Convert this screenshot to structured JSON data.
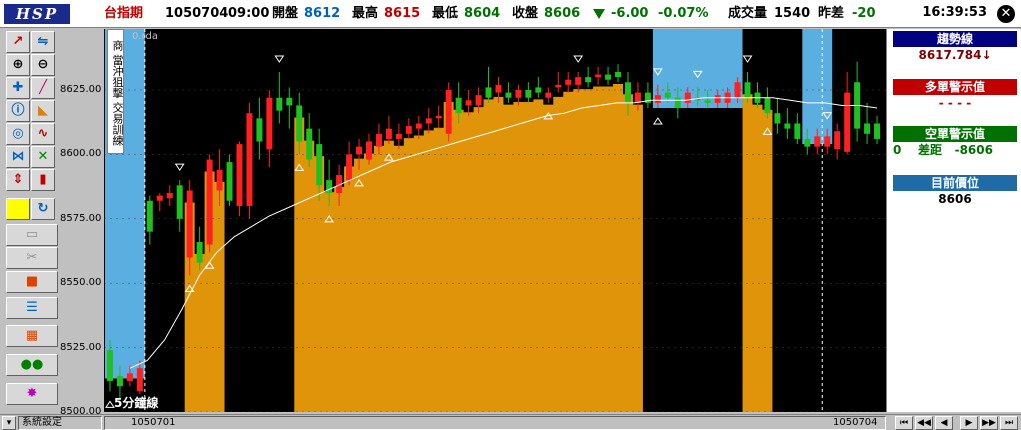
{
  "header": {
    "logo": "HSP",
    "symbol": "台指期",
    "date": "1050704",
    "time": "09:00",
    "open_label": "開盤",
    "open_value": "8612",
    "high_label": "最高",
    "high_value": "8615",
    "low_label": "最低",
    "low_value": "8604",
    "close_label": "收盤",
    "close_value": "8606",
    "change": "-6.00",
    "change_pct": "-0.07%",
    "volume_label": "成交量",
    "volume_value": "1540",
    "prev_diff_label": "昨差",
    "prev_diff_value": "-20",
    "clock": "16:39:53",
    "close_icon": "close-icon"
  },
  "toolbar": {
    "icons": [
      "trend-line-icon",
      "split-icon",
      "zoom-in-icon",
      "zoom-out-icon",
      "crosshair-icon",
      "pen-icon",
      "info-icon",
      "ruler-icon",
      "target-icon",
      "curve-icon",
      "pattern-icon",
      "cross-arrows-icon",
      "up-down-icon",
      "candle-icon",
      "color-swatch-icon",
      "refresh-icon",
      "folder-icon",
      "scissors-icon",
      "stop-icon",
      "list-icon",
      "grid-icon",
      "binoculars-icon",
      "alert-icon"
    ]
  },
  "chart_side_label": {
    "lines": [
      "商",
      "當沖狙擊",
      "交易訓練"
    ]
  },
  "chart_small_label": "0.rda",
  "interval_label": "5分鐘線",
  "chart_data": {
    "type": "candlestick",
    "y_ticks": [
      "8625.00",
      "8600.00",
      "8575.00",
      "8550.00",
      "8525.00",
      "8500.00"
    ],
    "ylim": [
      8500,
      8640
    ],
    "x_labels": [
      "1050701",
      "1050704"
    ],
    "candles": [
      {
        "o": 8524,
        "h": 8528,
        "l": 8508,
        "c": 8512
      },
      {
        "o": 8514,
        "h": 8518,
        "l": 8505,
        "c": 8510
      },
      {
        "o": 8512,
        "h": 8518,
        "l": 8510,
        "c": 8515
      },
      {
        "o": 8508,
        "h": 8520,
        "l": 8507,
        "c": 8517
      },
      {
        "o": 8582,
        "h": 8584,
        "l": 8565,
        "c": 8570
      },
      {
        "o": 8582,
        "h": 8585,
        "l": 8578,
        "c": 8584
      },
      {
        "o": 8583,
        "h": 8588,
        "l": 8580,
        "c": 8585
      },
      {
        "o": 8588,
        "h": 8590,
        "l": 8570,
        "c": 8575
      },
      {
        "o": 8560,
        "h": 8590,
        "l": 8553,
        "c": 8586
      },
      {
        "o": 8566,
        "h": 8572,
        "l": 8555,
        "c": 8558
      },
      {
        "o": 8565,
        "h": 8600,
        "l": 8562,
        "c": 8598
      },
      {
        "o": 8586,
        "h": 8602,
        "l": 8580,
        "c": 8594
      },
      {
        "o": 8597,
        "h": 8600,
        "l": 8580,
        "c": 8582
      },
      {
        "o": 8580,
        "h": 8605,
        "l": 8576,
        "c": 8604
      },
      {
        "o": 8580,
        "h": 8620,
        "l": 8575,
        "c": 8616
      },
      {
        "o": 8614,
        "h": 8622,
        "l": 8598,
        "c": 8605
      },
      {
        "o": 8602,
        "h": 8625,
        "l": 8595,
        "c": 8622
      },
      {
        "o": 8622,
        "h": 8632,
        "l": 8612,
        "c": 8617
      },
      {
        "o": 8622,
        "h": 8626,
        "l": 8610,
        "c": 8619
      },
      {
        "o": 8619,
        "h": 8624,
        "l": 8600,
        "c": 8605
      },
      {
        "o": 8610,
        "h": 8616,
        "l": 8595,
        "c": 8598
      },
      {
        "o": 8604,
        "h": 8610,
        "l": 8582,
        "c": 8588
      },
      {
        "o": 8590,
        "h": 8598,
        "l": 8580,
        "c": 8585
      },
      {
        "o": 8585,
        "h": 8596,
        "l": 8580,
        "c": 8592
      },
      {
        "o": 8590,
        "h": 8605,
        "l": 8588,
        "c": 8600
      },
      {
        "o": 8600,
        "h": 8606,
        "l": 8594,
        "c": 8603
      },
      {
        "o": 8598,
        "h": 8608,
        "l": 8596,
        "c": 8605
      },
      {
        "o": 8603,
        "h": 8612,
        "l": 8600,
        "c": 8608
      },
      {
        "o": 8606,
        "h": 8615,
        "l": 8604,
        "c": 8610
      },
      {
        "o": 8606,
        "h": 8612,
        "l": 8602,
        "c": 8608
      },
      {
        "o": 8608,
        "h": 8614,
        "l": 8606,
        "c": 8611
      },
      {
        "o": 8610,
        "h": 8615,
        "l": 8606,
        "c": 8612
      },
      {
        "o": 8612,
        "h": 8618,
        "l": 8608,
        "c": 8614
      },
      {
        "o": 8614,
        "h": 8619,
        "l": 8610,
        "c": 8615
      },
      {
        "o": 8608,
        "h": 8628,
        "l": 8605,
        "c": 8625
      },
      {
        "o": 8622,
        "h": 8628,
        "l": 8612,
        "c": 8616
      },
      {
        "o": 8619,
        "h": 8625,
        "l": 8615,
        "c": 8621
      },
      {
        "o": 8619,
        "h": 8626,
        "l": 8616,
        "c": 8623
      },
      {
        "o": 8626,
        "h": 8634,
        "l": 8620,
        "c": 8622
      },
      {
        "o": 8624,
        "h": 8630,
        "l": 8620,
        "c": 8627
      },
      {
        "o": 8624,
        "h": 8628,
        "l": 8620,
        "c": 8622
      },
      {
        "o": 8622,
        "h": 8627,
        "l": 8619,
        "c": 8625
      },
      {
        "o": 8625,
        "h": 8628,
        "l": 8620,
        "c": 8622
      },
      {
        "o": 8626,
        "h": 8630,
        "l": 8622,
        "c": 8624
      },
      {
        "o": 8622,
        "h": 8626,
        "l": 8620,
        "c": 8624
      },
      {
        "o": 8626,
        "h": 8632,
        "l": 8624,
        "c": 8627
      },
      {
        "o": 8627,
        "h": 8632,
        "l": 8624,
        "c": 8629
      },
      {
        "o": 8627,
        "h": 8632,
        "l": 8624,
        "c": 8630
      },
      {
        "o": 8630,
        "h": 8634,
        "l": 8626,
        "c": 8628
      },
      {
        "o": 8630,
        "h": 8634,
        "l": 8627,
        "c": 8631
      },
      {
        "o": 8631,
        "h": 8634,
        "l": 8627,
        "c": 8629
      },
      {
        "o": 8632,
        "h": 8635,
        "l": 8628,
        "c": 8630
      },
      {
        "o": 8628,
        "h": 8632,
        "l": 8615,
        "c": 8620
      },
      {
        "o": 8620,
        "h": 8628,
        "l": 8617,
        "c": 8624
      },
      {
        "o": 8624,
        "h": 8628,
        "l": 8618,
        "c": 8620
      },
      {
        "o": 8620,
        "h": 8627,
        "l": 8618,
        "c": 8623
      },
      {
        "o": 8624,
        "h": 8628,
        "l": 8620,
        "c": 8622
      },
      {
        "o": 8622,
        "h": 8626,
        "l": 8614,
        "c": 8618
      },
      {
        "o": 8620,
        "h": 8626,
        "l": 8618,
        "c": 8624
      },
      {
        "o": 8622,
        "h": 8626,
        "l": 8619,
        "c": 8621
      },
      {
        "o": 8621,
        "h": 8625,
        "l": 8618,
        "c": 8620
      },
      {
        "o": 8620,
        "h": 8625,
        "l": 8618,
        "c": 8623
      },
      {
        "o": 8620,
        "h": 8626,
        "l": 8618,
        "c": 8624
      },
      {
        "o": 8622,
        "h": 8630,
        "l": 8620,
        "c": 8628
      },
      {
        "o": 8628,
        "h": 8632,
        "l": 8620,
        "c": 8622
      },
      {
        "o": 8624,
        "h": 8628,
        "l": 8618,
        "c": 8620
      },
      {
        "o": 8622,
        "h": 8626,
        "l": 8614,
        "c": 8616
      },
      {
        "o": 8616,
        "h": 8622,
        "l": 8608,
        "c": 8612
      },
      {
        "o": 8612,
        "h": 8618,
        "l": 8606,
        "c": 8610
      },
      {
        "o": 8612,
        "h": 8616,
        "l": 8604,
        "c": 8606
      },
      {
        "o": 8606,
        "h": 8610,
        "l": 8600,
        "c": 8603
      },
      {
        "o": 8603,
        "h": 8610,
        "l": 8600,
        "c": 8607
      },
      {
        "o": 8603,
        "h": 8610,
        "l": 8600,
        "c": 8607
      },
      {
        "o": 8602,
        "h": 8612,
        "l": 8598,
        "c": 8609
      },
      {
        "o": 8601,
        "h": 8632,
        "l": 8600,
        "c": 8624
      },
      {
        "o": 8628,
        "h": 8636,
        "l": 8605,
        "c": 8610
      },
      {
        "o": 8612,
        "h": 8620,
        "l": 8604,
        "c": 8608
      },
      {
        "o": 8612,
        "h": 8615,
        "l": 8604,
        "c": 8606
      }
    ],
    "trend_line": [
      8517,
      8520,
      8528,
      8540,
      8553,
      8562,
      8568,
      8572,
      8576,
      8579,
      8582,
      8585,
      8588,
      8591,
      8594,
      8597,
      8599,
      8601,
      8603,
      8605,
      8607,
      8609,
      8611,
      8613,
      8615,
      8616,
      8618,
      8619,
      8620,
      8620,
      8621,
      8621,
      8621,
      8622,
      8622,
      8622,
      8622,
      8622,
      8621,
      8620,
      8620,
      8619,
      8619,
      8618
    ],
    "price_line": 8606
  },
  "right_panel": {
    "trend_label": "趨勢線",
    "trend_value": "8617.784↓",
    "long_alert_label": "多單警示值",
    "long_alert_value": "- - - -",
    "short_alert_label": "空單警示值",
    "short_alert_value": "0    差距   -8606",
    "position_label": "目前價位",
    "position_value": "8606",
    "colors": {
      "trend": "#000080",
      "long": "#c00000",
      "short": "#007000",
      "position": "#1e6ba8"
    }
  },
  "bottom_bar": {
    "settings_label": "系統設定",
    "date_left": "1050701",
    "date_right": "1050704",
    "nav": [
      "⏮",
      "◀◀",
      "◀",
      "▶",
      "▶▶",
      "⏭"
    ]
  }
}
